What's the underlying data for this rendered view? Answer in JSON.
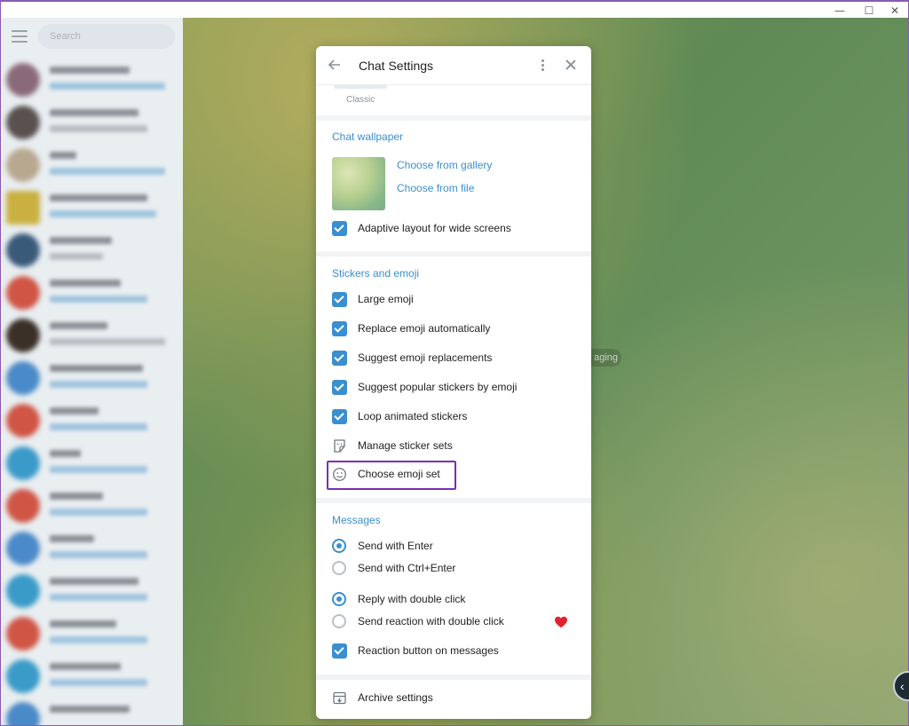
{
  "sidebar": {
    "search_placeholder": "Search"
  },
  "background": {
    "pill_text": "aging"
  },
  "dialog": {
    "title": "Chat Settings",
    "theme_label": "Classic",
    "wallpaper": {
      "section_title": "Chat wallpaper",
      "choose_gallery": "Choose from gallery",
      "choose_file": "Choose from file",
      "adaptive_layout": "Adaptive layout for wide screens"
    },
    "stickers": {
      "section_title": "Stickers and emoji",
      "large_emoji": "Large emoji",
      "replace_emoji": "Replace emoji automatically",
      "suggest_replacements": "Suggest emoji replacements",
      "suggest_popular": "Suggest popular stickers by emoji",
      "loop_animated": "Loop animated stickers",
      "manage_sets": "Manage sticker sets",
      "choose_emoji_set": "Choose emoji set"
    },
    "messages": {
      "section_title": "Messages",
      "send_enter": "Send with Enter",
      "send_ctrl_enter": "Send with Ctrl+Enter",
      "reply_double_click": "Reply with double click",
      "reaction_double_click": "Send reaction with double click",
      "reaction_button": "Reaction button on messages"
    },
    "archive": "Archive settings"
  },
  "colors": {
    "accent": "#3a8fce",
    "highlight": "#7b2fb0",
    "heart": "#e0232e"
  }
}
